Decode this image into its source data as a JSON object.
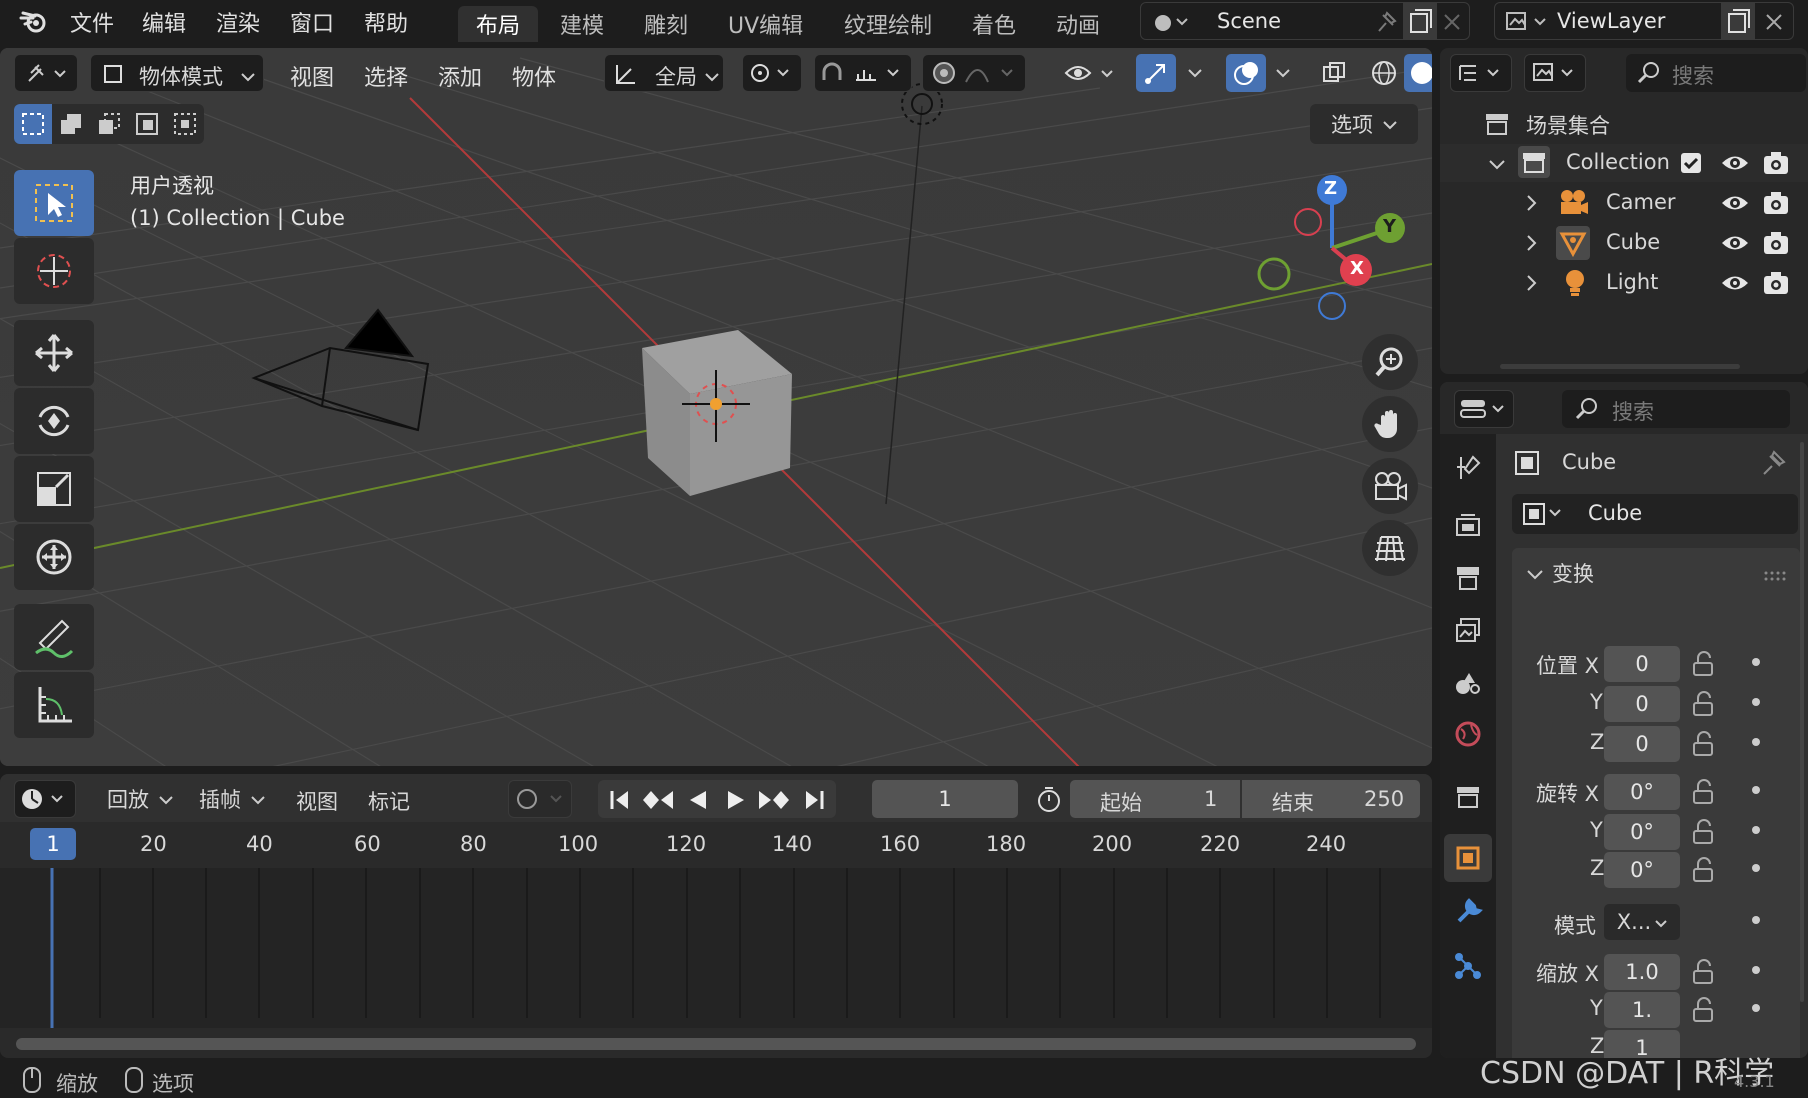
{
  "topbar": {
    "menus": [
      "文件",
      "编辑",
      "渲染",
      "窗口",
      "帮助"
    ],
    "workspaces": [
      "布局",
      "建模",
      "雕刻",
      "UV编辑",
      "纹理绘制",
      "着色",
      "动画"
    ],
    "active_workspace": "布局",
    "scene": "Scene",
    "view_layer": "ViewLayer"
  },
  "viewport": {
    "mode": "物体模式",
    "menus": [
      "视图",
      "选择",
      "添加",
      "物体"
    ],
    "transform_orientation": "全局",
    "options_label": "选项",
    "view_name": "用户透视",
    "object_info": "(1) Collection | Cube",
    "gizmo_axes": {
      "z": "Z",
      "y": "Y",
      "x": "X"
    }
  },
  "outliner": {
    "search_placeholder": "搜索",
    "scene_collection": "场景集合",
    "collection": "Collection",
    "items": [
      {
        "label": "Camer",
        "icon": "camera-icon"
      },
      {
        "label": "Cube",
        "icon": "mesh-icon"
      },
      {
        "label": "Light",
        "icon": "light-icon"
      }
    ]
  },
  "properties": {
    "search_placeholder": "搜索",
    "object_name": "Cube",
    "object_field": "Cube",
    "transform_title": "变换",
    "location_label": "位置 X",
    "rotation_label": "旋转 X",
    "mode_label": "模式",
    "scale_label": "缩放 X",
    "axis_y": "Y",
    "axis_z": "Z",
    "location": [
      "0",
      "0",
      "0"
    ],
    "rotation": [
      "0°",
      "0°",
      "0°"
    ],
    "rotation_mode": "X...",
    "scale": [
      "1.0",
      "1.",
      "1"
    ]
  },
  "timeline": {
    "menus": [
      "回放",
      "插帧",
      "视图",
      "标记"
    ],
    "current_frame": "1",
    "start_label": "起始",
    "start_value": "1",
    "end_label": "结束",
    "end_value": "250",
    "ruler_current": "1",
    "ruler": [
      "20",
      "40",
      "60",
      "80",
      "100",
      "120",
      "140",
      "160",
      "180",
      "200",
      "220",
      "240"
    ]
  },
  "statusbar": {
    "zoom_label": "缩放",
    "select_label": "选项",
    "watermark": "CSDN @DAT | R科学",
    "version": "4.3.1"
  }
}
